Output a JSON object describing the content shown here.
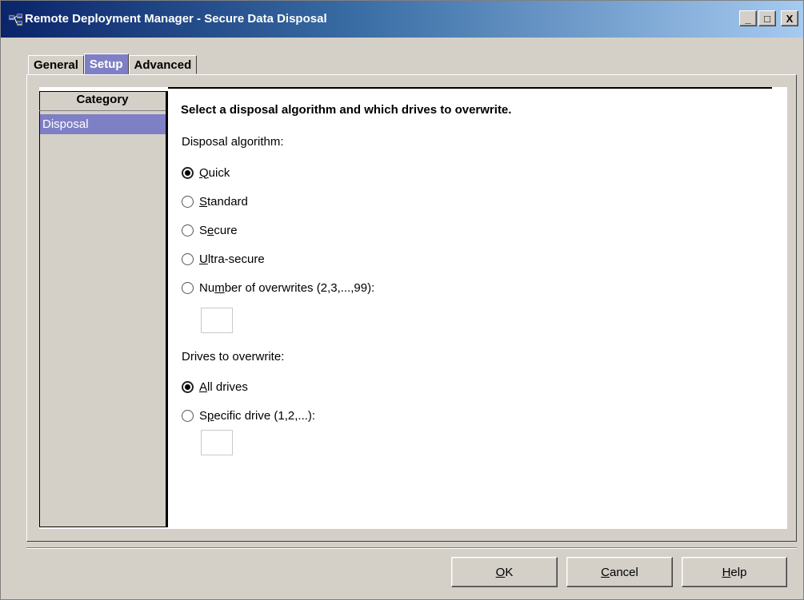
{
  "window": {
    "title": "Remote Deployment Manager - Secure Data Disposal",
    "controls": [
      "_",
      "□",
      "X"
    ]
  },
  "tabs": [
    {
      "label": "General",
      "active": false
    },
    {
      "label": "Setup",
      "active": true
    },
    {
      "label": "Advanced",
      "active": false
    }
  ],
  "sidebar": {
    "header": "Category",
    "items": [
      {
        "label": "Disposal",
        "selected": true
      }
    ]
  },
  "main": {
    "heading": "Select a disposal algorithm and which drives to overwrite.",
    "algorithm_label": "Disposal algorithm:",
    "algorithms": [
      {
        "pre": "",
        "mn": "Q",
        "post": "uick",
        "checked": true
      },
      {
        "pre": "",
        "mn": "S",
        "post": "tandard",
        "checked": false
      },
      {
        "pre": "S",
        "mn": "e",
        "post": "cure",
        "checked": false
      },
      {
        "pre": "",
        "mn": "U",
        "post": "ltra-secure",
        "checked": false
      },
      {
        "pre": "Nu",
        "mn": "m",
        "post": "ber of overwrites  (2,3,...,99):",
        "checked": false
      }
    ],
    "overwrites_value": "",
    "drives_label": "Drives to overwrite:",
    "drives": [
      {
        "pre": "",
        "mn": "A",
        "post": "ll drives",
        "checked": true
      },
      {
        "pre": "S",
        "mn": "p",
        "post": "ecific drive  (1,2,...):",
        "checked": false
      }
    ],
    "drive_value": ""
  },
  "buttons": {
    "ok": {
      "mn": "O",
      "post": "K"
    },
    "cancel": {
      "mn": "C",
      "post": "ancel"
    },
    "help": {
      "mn": "H",
      "post": "elp"
    }
  },
  "colors": {
    "title_start": "#0a246a",
    "title_end": "#a6caf0",
    "selection": "#7f7fc6",
    "face": "#d4d0c8"
  }
}
